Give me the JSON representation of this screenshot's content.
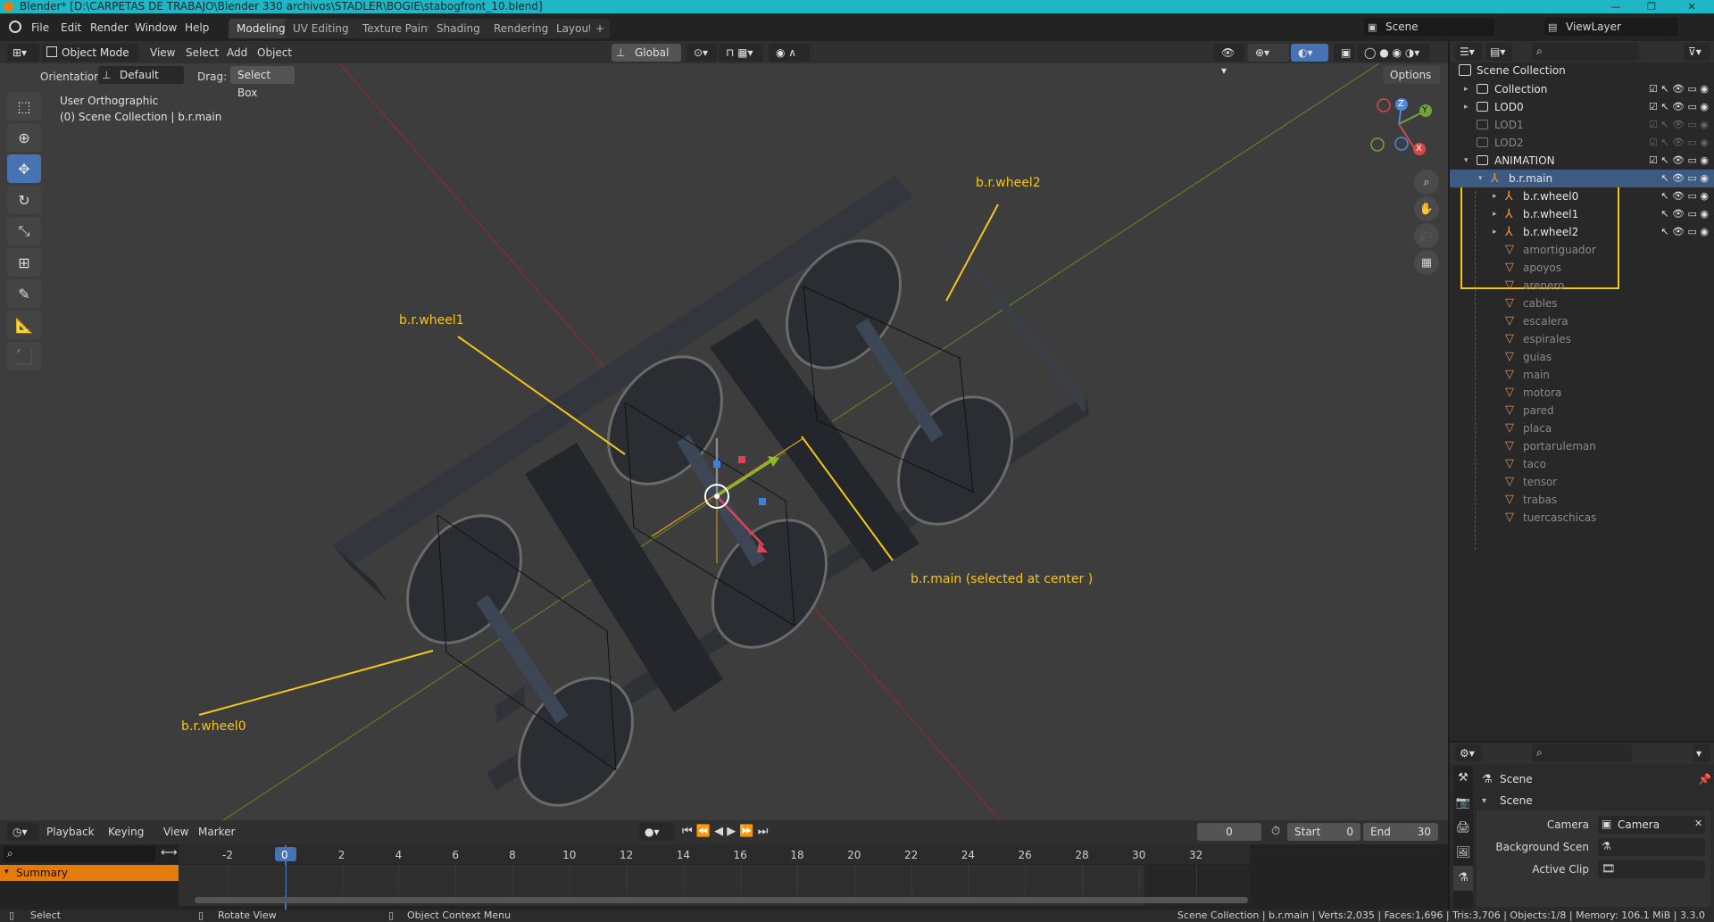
{
  "window": {
    "title": "Blender* [D:\\CARPETAS DE TRABAJO\\Blender 330 archivos\\STADLER\\BOGIE\\stabogfront_10.blend]",
    "minimize": "—",
    "maximize": "❐",
    "close": "✕"
  },
  "menu": [
    "File",
    "Edit",
    "Render",
    "Window",
    "Help"
  ],
  "workspaces": [
    "Modeling",
    "UV Editing",
    "Texture Paint",
    "Shading",
    "Rendering",
    "Layout"
  ],
  "workspace_add": "+",
  "scene_field": "Scene",
  "viewlayer_field": "ViewLayer",
  "viewport_header": {
    "mode": "Object Mode",
    "menus": [
      "View",
      "Select",
      "Add",
      "Object"
    ],
    "transform_orientation": "Global",
    "orientation_label": "Orientation:",
    "orientation_value": "Default",
    "drag_label": "Drag:",
    "drag_value": "Select Box",
    "options": "Options"
  },
  "viewport_info": {
    "view_name": "User Orthographic",
    "collection_line": "(0) Scene Collection | b.r.main"
  },
  "annotations": {
    "wheel2": "b.r.wheel2",
    "wheel1": "b.r.wheel1",
    "main": "b.r.main  (selected at center )",
    "wheel0": "b.r.wheel0"
  },
  "gizmo_axes": {
    "x": "X",
    "y": "Y",
    "z": "Z"
  },
  "outliner": {
    "root": "Scene Collection",
    "rows": [
      {
        "label": "Collection",
        "type": "collection",
        "depth": 1,
        "expandable": true,
        "enabled": true
      },
      {
        "label": "LOD0",
        "type": "collection",
        "depth": 1,
        "expandable": true,
        "enabled": true
      },
      {
        "label": "LOD1",
        "type": "collection",
        "depth": 1,
        "expandable": false,
        "enabled": false
      },
      {
        "label": "LOD2",
        "type": "collection",
        "depth": 1,
        "expandable": false,
        "enabled": false
      },
      {
        "label": "ANIMATION",
        "type": "collection",
        "depth": 1,
        "expandable": true,
        "enabled": true
      },
      {
        "label": "b.r.main",
        "type": "armature",
        "depth": 2,
        "expandable": true,
        "enabled": true,
        "selected": true
      },
      {
        "label": "b.r.wheel0",
        "type": "armature",
        "depth": 3,
        "expandable": true,
        "enabled": true
      },
      {
        "label": "b.r.wheel1",
        "type": "armature",
        "depth": 3,
        "expandable": true,
        "enabled": true
      },
      {
        "label": "b.r.wheel2",
        "type": "armature",
        "depth": 3,
        "expandable": true,
        "enabled": true
      },
      {
        "label": "amortiguador",
        "type": "mesh",
        "depth": 3,
        "expandable": false,
        "enabled": false
      },
      {
        "label": "apoyos",
        "type": "mesh",
        "depth": 3,
        "expandable": false,
        "enabled": false
      },
      {
        "label": "arenero",
        "type": "mesh",
        "depth": 3,
        "expandable": false,
        "enabled": false
      },
      {
        "label": "cables",
        "type": "mesh",
        "depth": 3,
        "expandable": false,
        "enabled": false
      },
      {
        "label": "escalera",
        "type": "mesh",
        "depth": 3,
        "expandable": false,
        "enabled": false
      },
      {
        "label": "espirales",
        "type": "mesh",
        "depth": 3,
        "expandable": false,
        "enabled": false
      },
      {
        "label": "guias",
        "type": "mesh",
        "depth": 3,
        "expandable": false,
        "enabled": false
      },
      {
        "label": "main",
        "type": "mesh",
        "depth": 3,
        "expandable": false,
        "enabled": false
      },
      {
        "label": "motora",
        "type": "mesh",
        "depth": 3,
        "expandable": false,
        "enabled": false
      },
      {
        "label": "pared",
        "type": "mesh",
        "depth": 3,
        "expandable": false,
        "enabled": false
      },
      {
        "label": "placa",
        "type": "mesh",
        "depth": 3,
        "expandable": false,
        "enabled": false
      },
      {
        "label": "portaruleman",
        "type": "mesh",
        "depth": 3,
        "expandable": false,
        "enabled": false
      },
      {
        "label": "taco",
        "type": "mesh",
        "depth": 3,
        "expandable": false,
        "enabled": false
      },
      {
        "label": "tensor",
        "type": "mesh",
        "depth": 3,
        "expandable": false,
        "enabled": false
      },
      {
        "label": "trabas",
        "type": "mesh",
        "depth": 3,
        "expandable": false,
        "enabled": false
      },
      {
        "label": "tuercaschicas",
        "type": "mesh",
        "depth": 3,
        "expandable": false,
        "enabled": false
      }
    ]
  },
  "properties": {
    "context": "Scene",
    "panel": "Scene",
    "camera_label": "Camera",
    "camera_value": "Camera",
    "background_label": "Background Scen",
    "background_value": "",
    "clip_label": "Active Clip",
    "clip_value": ""
  },
  "timeline": {
    "menus": [
      "Playback",
      "Keying",
      "View",
      "Marker"
    ],
    "current_frame": "0",
    "start_label": "Start",
    "start": "0",
    "end_label": "End",
    "end": "30",
    "summary": "Summary",
    "ticks": [
      "-2",
      "0",
      "2",
      "4",
      "6",
      "8",
      "10",
      "12",
      "14",
      "16",
      "18",
      "20",
      "22",
      "24",
      "26",
      "28",
      "30",
      "32"
    ]
  },
  "statusbar": {
    "left1": "Select",
    "left2": "Rotate View",
    "left3": "Object Context Menu",
    "right": "Scene Collection | b.r.main | Verts:2,035 | Faces:1,696 | Tris:3,706 | Objects:1/8 | Memory: 106.1 MiB | 3.3.0"
  },
  "colors": {
    "accent": "#4772b3",
    "annotation": "#f5c518",
    "titlebar": "#1fb7c6",
    "summary": "#e37c0d"
  }
}
